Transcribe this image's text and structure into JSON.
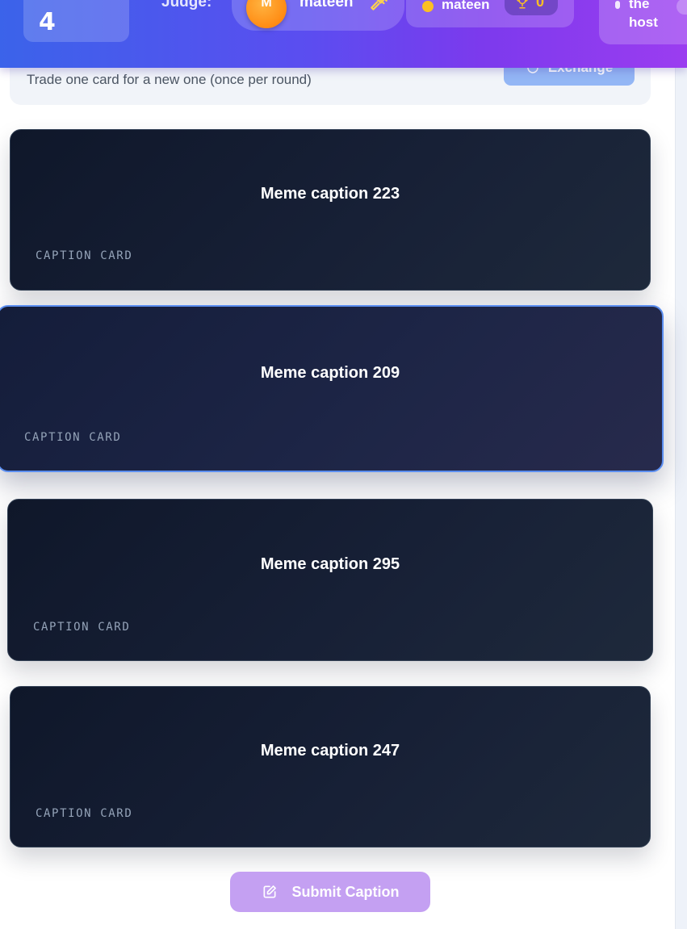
{
  "header": {
    "round_number": "4",
    "judge_label": "Judge:",
    "judge": {
      "avatar_initial": "M",
      "name": "mateen",
      "icon": "gavel-icon"
    },
    "player": {
      "name": "mateen",
      "score": "0",
      "icon": "trophy-icon",
      "status_color": "#fbbf24"
    },
    "host": {
      "text": "the host"
    }
  },
  "exchange": {
    "hint": "Trade one card for a new one (once per round)",
    "button_label": "Exchange",
    "icon": "refresh-icon"
  },
  "cards": [
    {
      "caption": "Meme caption 223",
      "tag": "CAPTION CARD",
      "selected": false
    },
    {
      "caption": "Meme caption 209",
      "tag": "CAPTION CARD",
      "selected": true
    },
    {
      "caption": "Meme caption 295",
      "tag": "CAPTION CARD",
      "selected": false
    },
    {
      "caption": "Meme caption 247",
      "tag": "CAPTION CARD",
      "selected": false
    }
  ],
  "submit": {
    "label": "Submit Caption",
    "icon": "edit-icon"
  },
  "colors": {
    "header_start": "#3b63ea",
    "header_end": "#9b3df0",
    "card_bg": "#0f172a",
    "selected_border": "#5b8ef0",
    "submit_bg": "#c4a0f2",
    "exchange_bg": "#93b6f5"
  }
}
